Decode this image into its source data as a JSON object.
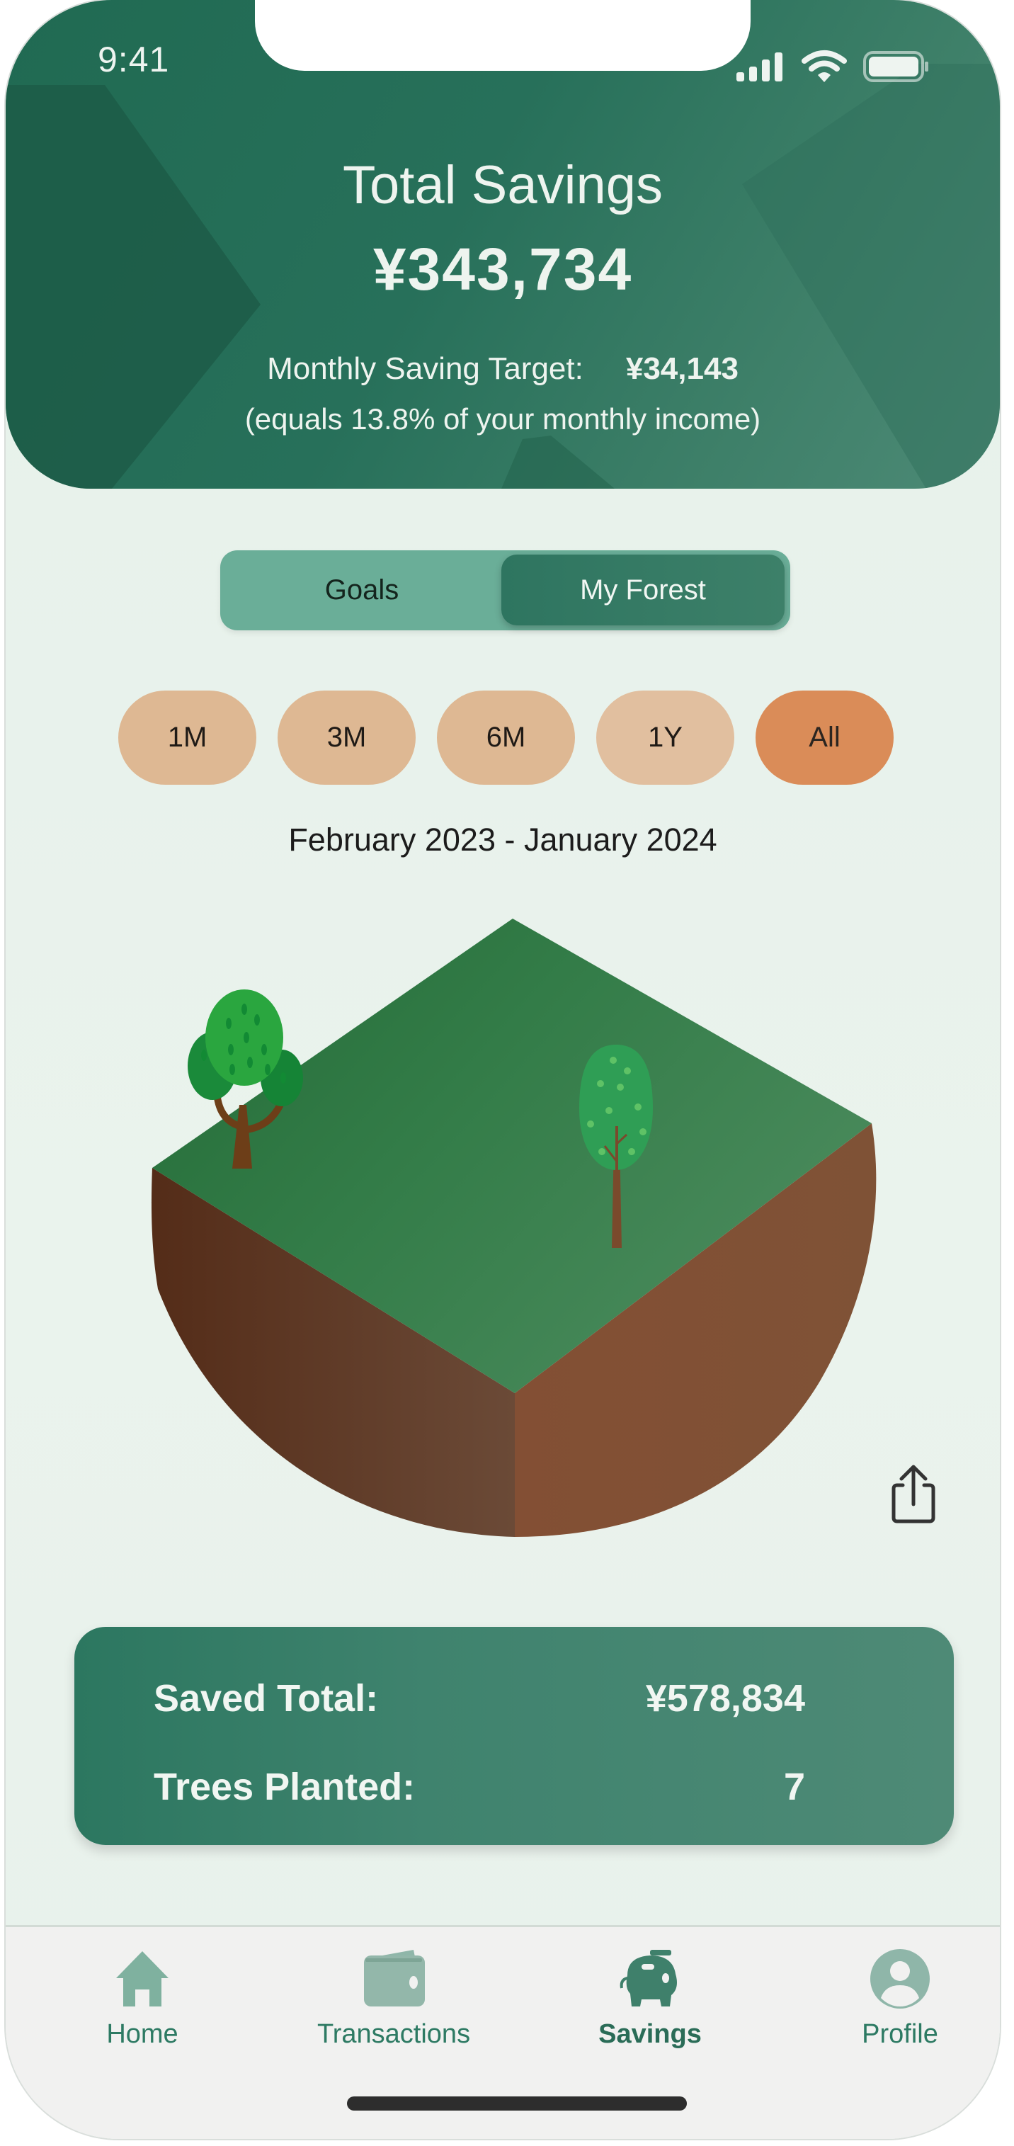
{
  "status_bar": {
    "time": "9:41",
    "icons": [
      "cellular-signal-icon",
      "wifi-icon",
      "battery-icon"
    ]
  },
  "header": {
    "title": "Total Savings",
    "total_amount": "¥343,734",
    "monthly_target_label": "Monthly Saving Target:",
    "monthly_target_value": "¥34,143",
    "income_note": "(equals 13.8% of your monthly income)"
  },
  "view_toggle": {
    "options": [
      {
        "label": "Goals",
        "active": false
      },
      {
        "label": "My Forest",
        "active": true
      }
    ]
  },
  "range_filters": {
    "options": [
      {
        "label": "1M",
        "active": false
      },
      {
        "label": "3M",
        "active": false
      },
      {
        "label": "6M",
        "active": false
      },
      {
        "label": "1Y",
        "active": false
      },
      {
        "label": "All",
        "active": true
      }
    ]
  },
  "date_range": "February 2023 - January 2024",
  "forest": {
    "trees_shown": [
      "oak-tree",
      "poplar-tree"
    ],
    "share_icon": "share-icon"
  },
  "summary": {
    "saved_total_label": "Saved Total:",
    "saved_total_value": "¥578,834",
    "trees_planted_label": "Trees Planted:",
    "trees_planted_value": "7"
  },
  "tab_bar": {
    "items": [
      {
        "label": "Home",
        "icon": "home-icon",
        "active": false
      },
      {
        "label": "Transactions",
        "icon": "wallet-icon",
        "active": false
      },
      {
        "label": "Savings",
        "icon": "piggy-bank-icon",
        "active": true
      },
      {
        "label": "Profile",
        "icon": "profile-icon",
        "active": false
      }
    ]
  },
  "colors": {
    "primary_green": "#27705a",
    "toggle_bg": "#6aae98",
    "pill": "#deb893",
    "pill_active": "#da8c58",
    "background": "#e8f1eb"
  }
}
